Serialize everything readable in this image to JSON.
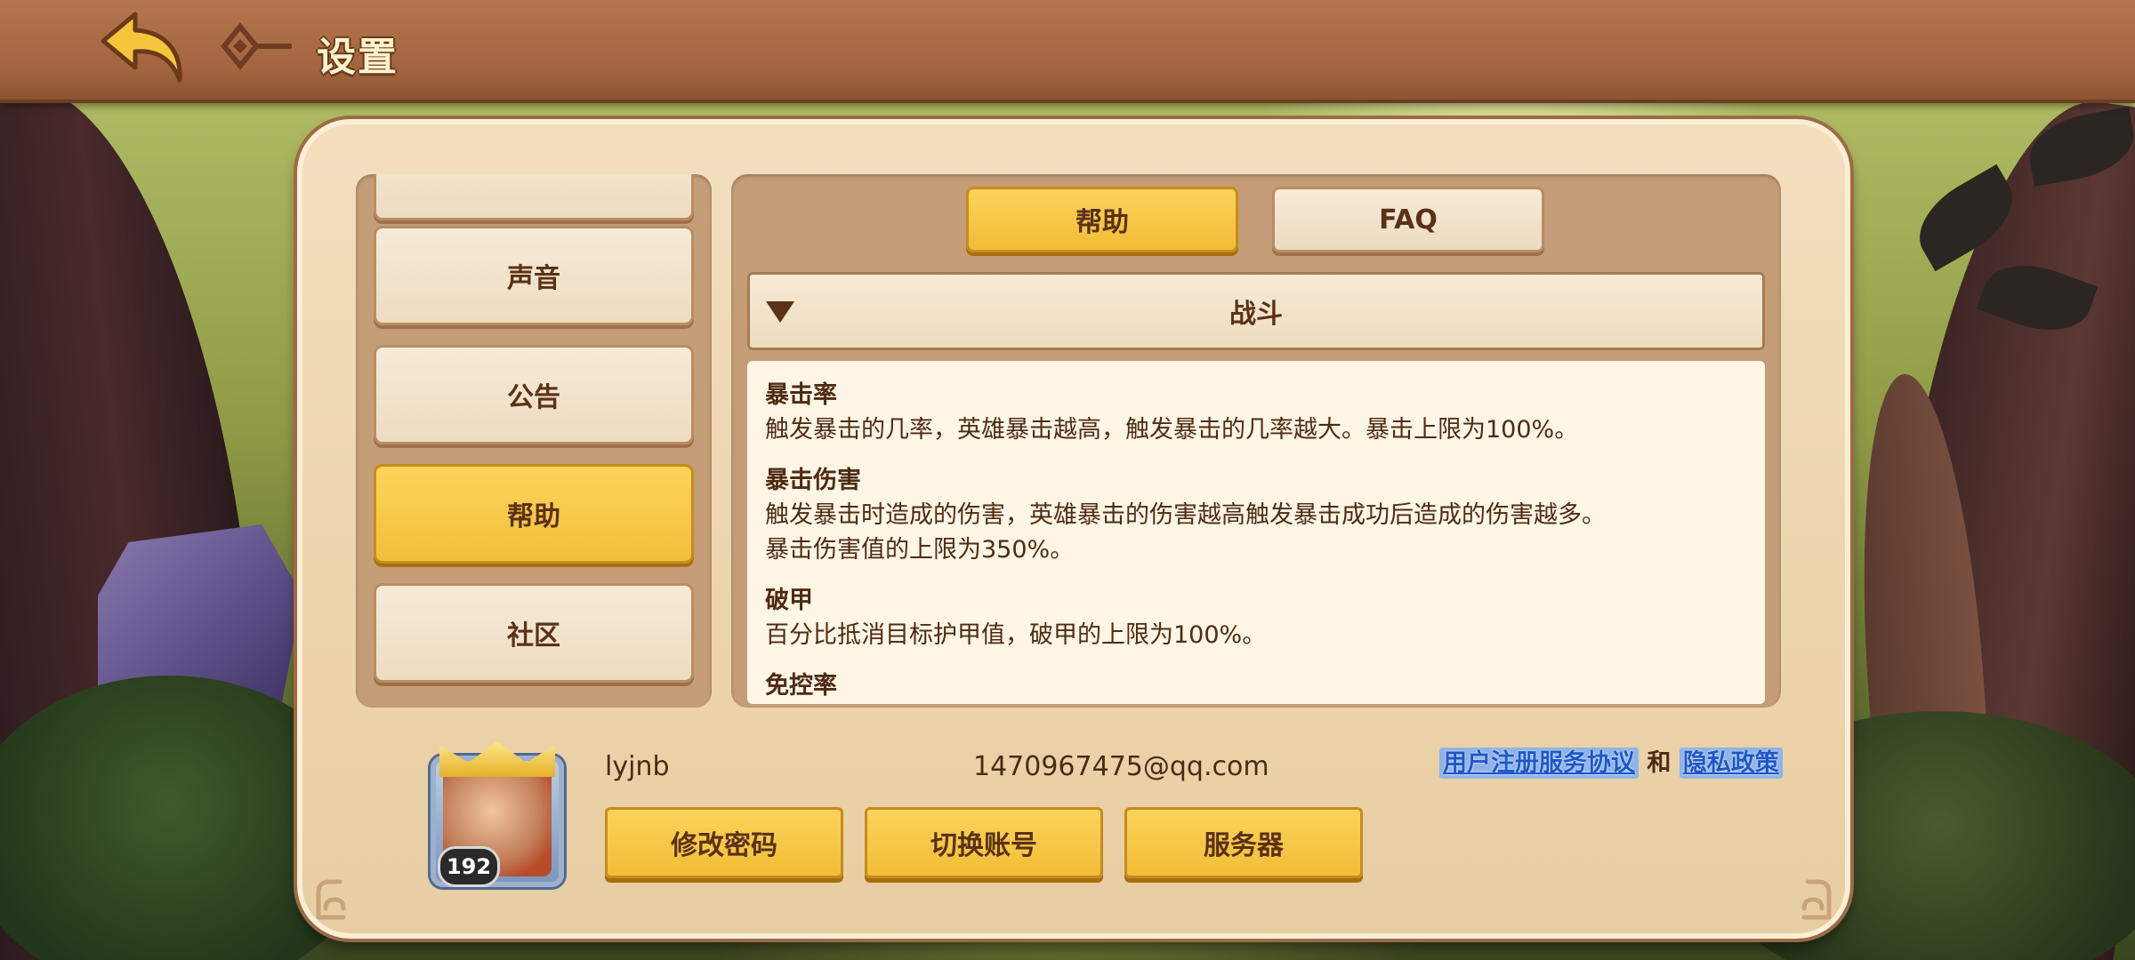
{
  "header": {
    "title": "设置"
  },
  "menu": {
    "items": [
      {
        "label": ""
      },
      {
        "label": "声音"
      },
      {
        "label": "公告"
      },
      {
        "label": "帮助",
        "active": true
      },
      {
        "label": "社区"
      }
    ]
  },
  "tabs": [
    {
      "label": "帮助",
      "active": true
    },
    {
      "label": "FAQ",
      "active": false
    }
  ],
  "section": {
    "title": "战斗",
    "expanded": true
  },
  "help_content": {
    "paragraphs": [
      {
        "heading": "暴击率",
        "lines": [
          "触发暴击的几率，英雄暴击越高，触发暴击的几率越大。暴击上限为100%。"
        ]
      },
      {
        "heading": "暴击伤害",
        "lines": [
          "触发暴击时造成的伤害，英雄暴击的伤害越高触发暴击成功后造成的伤害越多。",
          "暴击伤害值的上限为350%。"
        ]
      },
      {
        "heading": "破甲",
        "lines": [
          "百分比抵消目标护甲值，破甲的上限为100%。"
        ]
      },
      {
        "heading": "免控率",
        "lines": []
      }
    ]
  },
  "account": {
    "username": "lyjnb",
    "email": "1470967475@qq.com",
    "level": "192",
    "agreement_link": "用户注册服务协议",
    "and_text": "和",
    "privacy_link": "隐私政策",
    "buttons": {
      "change_password": "修改密码",
      "switch_account": "切换账号",
      "server": "服务器"
    }
  },
  "colors": {
    "accent_yellow": "#f3c03a",
    "panel_bg": "#f3dfbd",
    "text_brown": "#5a3218",
    "link_blue": "#1f57c8"
  }
}
